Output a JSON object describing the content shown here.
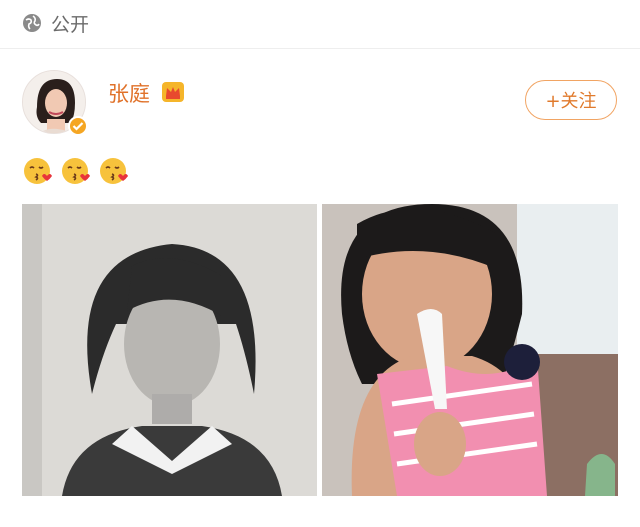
{
  "header": {
    "visibility_label": "公开",
    "visibility_icon": "globe-icon"
  },
  "post": {
    "author": {
      "name": "张庭",
      "verified": true,
      "badge_icon": "crown-icon"
    },
    "follow_label": "+关注",
    "body_emojis": [
      "kiss-emoji",
      "kiss-emoji",
      "kiss-emoji"
    ],
    "images": [
      {
        "description_icon": "photo-black-white-portrait"
      },
      {
        "description_icon": "photo-girl-eating-icecream"
      }
    ]
  },
  "colors": {
    "accent": "#e07a2c",
    "username": "#e0722a",
    "follow_border": "#f1a463",
    "muted": "#6b6b6b"
  }
}
